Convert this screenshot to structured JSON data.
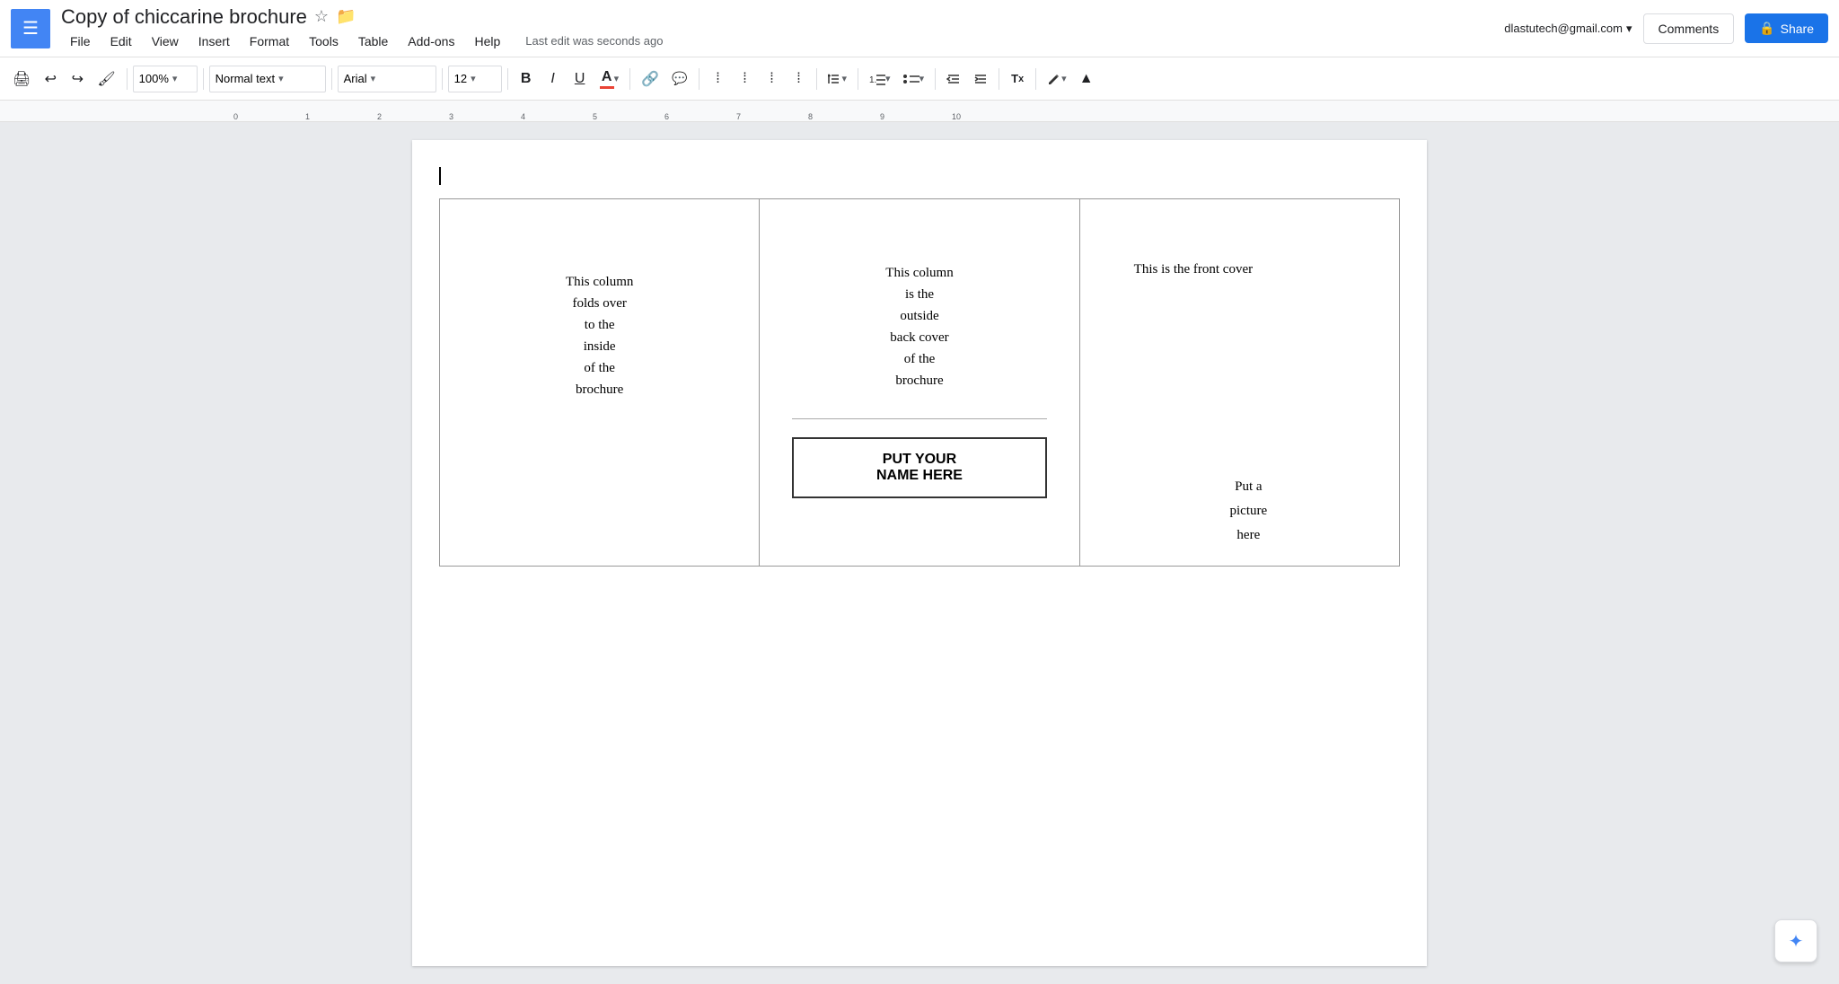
{
  "app": {
    "menu_icon": "☰",
    "title": "Copy of chiccarine brochure",
    "star_icon": "☆",
    "folder_icon": "▬"
  },
  "menu": {
    "items": [
      "File",
      "Edit",
      "View",
      "Insert",
      "Format",
      "Tools",
      "Table",
      "Add-ons",
      "Help"
    ]
  },
  "status": {
    "last_edit": "Last edit was seconds ago"
  },
  "user": {
    "email": "dlastutech@gmail.com",
    "dropdown_icon": "▾"
  },
  "buttons": {
    "comments": "Comments",
    "share": "Share",
    "share_icon": "🔒"
  },
  "toolbar": {
    "print": "🖨",
    "undo": "↩",
    "redo": "↪",
    "paint_format": "🖌",
    "zoom_value": "100%",
    "zoom_chevron": "▾",
    "style_value": "Normal text",
    "style_chevron": "▾",
    "font_value": "Arial",
    "font_chevron": "▾",
    "size_value": "12",
    "size_chevron": "▾",
    "bold": "B",
    "italic": "I",
    "underline": "U",
    "font_color": "A",
    "link": "🔗",
    "comment_inline": "💬",
    "align_left": "≡",
    "align_center": "≡",
    "align_right": "≡",
    "align_justify": "≡",
    "line_spacing": "↕",
    "numbered_list": "1.",
    "bullet_list": "•",
    "indent_less": "←",
    "indent_more": "→",
    "clear_format": "Tx",
    "pen": "✏",
    "collapse": "▲"
  },
  "document": {
    "col1_text": "This column\nfolds over\nto the\ninside\nof the\nbrochure",
    "col2_top_text": "This column\nis the\noutside\nback cover\nof the\nbrochure",
    "name_box_text": "PUT YOUR\nNAME HERE",
    "col3_top_text": "This is the front cover",
    "col3_picture_text": "Put a\npicture\nhere"
  },
  "ai_button": {
    "icon": "✦"
  }
}
